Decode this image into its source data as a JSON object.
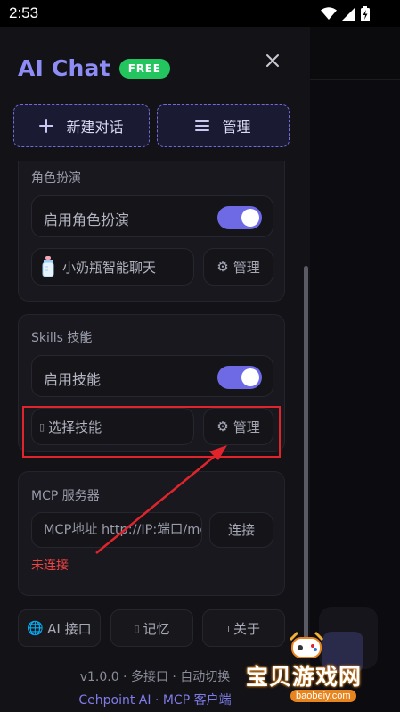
{
  "status_bar": {
    "time": "2:53"
  },
  "drawer": {
    "app_name": "AI Chat",
    "badge": "FREE",
    "new_chat_label": "新建对话",
    "manage_label": "管理"
  },
  "roleplay": {
    "section_title": "角色扮演",
    "enable_label": "启用角色扮演",
    "enabled": true,
    "selected_role": "小奶瓶智能聊天",
    "manage_label": "管理"
  },
  "skills": {
    "section_title": "Skills 技能",
    "enable_label": "启用技能",
    "enabled": true,
    "select_label": "选择技能",
    "manage_label": "管理"
  },
  "mcp": {
    "section_title": "MCP 服务器",
    "address_placeholder": "MCP地址 http://IP:端口/mcp",
    "connect_label": "连接",
    "status": "未连接"
  },
  "bottom_nav": {
    "ai_api": "AI 接口",
    "memory": "记忆",
    "about": "关于"
  },
  "footer": {
    "version_line": "v1.0.0 · 多接口 · 自动切换",
    "credit_line": "Cehpoint AI · MCP 客户端"
  },
  "watermark": {
    "site_name": "宝贝游戏网",
    "url": "baobeiy.com"
  },
  "colors": {
    "accent": "#6e6ae6",
    "brand_text": "#8e8cf5",
    "badge_green": "#22c55e",
    "error_red": "#ef4444",
    "annotation_red": "#e0242c"
  },
  "icons": {
    "new_chat": "plus-icon",
    "manage": "menu-icon",
    "close": "close-icon",
    "role": "baby-bottle-icon",
    "settings": "gear-icon",
    "api": "globe-icon"
  }
}
